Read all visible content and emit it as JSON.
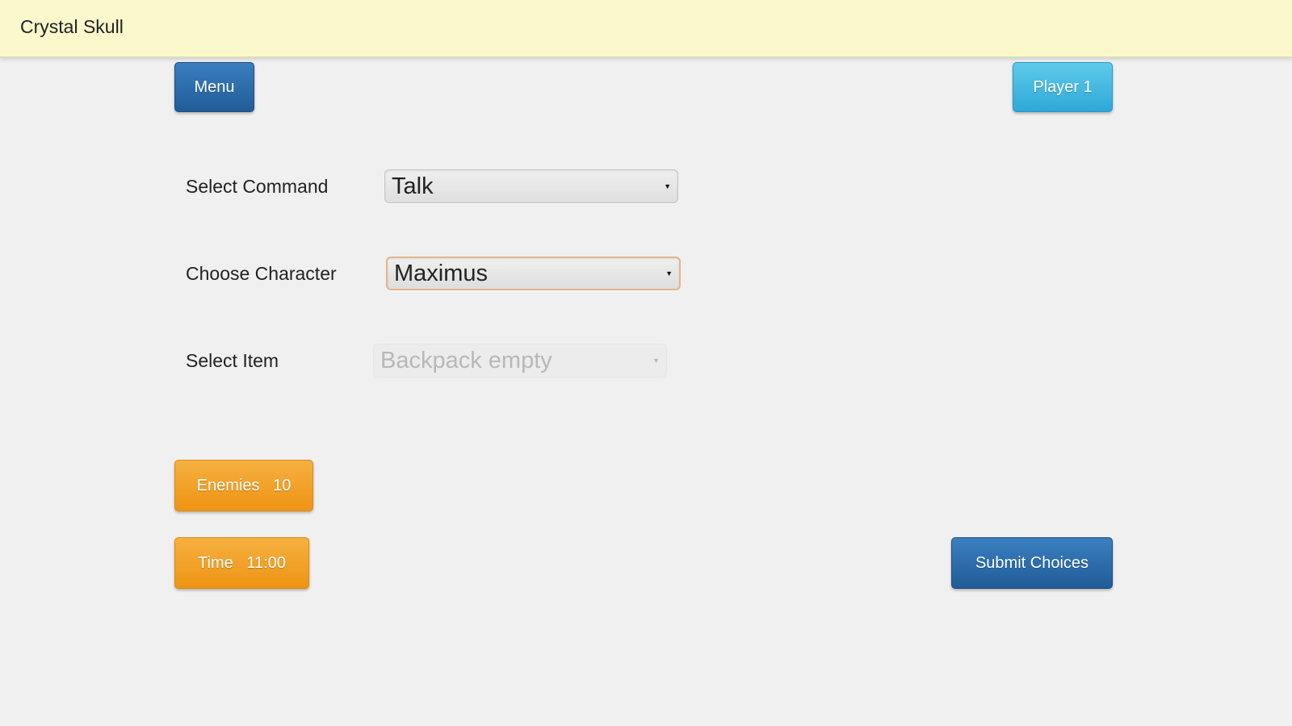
{
  "app": {
    "title": "Crystal Skull"
  },
  "toolbar": {
    "menu_label": "Menu",
    "player_label": "Player 1"
  },
  "form": {
    "command": {
      "label": "Select Command",
      "value": "Talk"
    },
    "character": {
      "label": "Choose Character",
      "value": "Maximus"
    },
    "item": {
      "label": "Select Item",
      "value": "Backpack empty",
      "disabled": true
    }
  },
  "status": {
    "enemies_label": "Enemies   10",
    "time_label": "Time   11:00"
  },
  "actions": {
    "submit_label": "Submit Choices"
  },
  "icons": {
    "dropdown": "caret-down-icon"
  },
  "colors": {
    "title_bar": "#fbf9cc",
    "primary_blue": "#215c97",
    "player_cyan": "#2ea8d8",
    "status_orange": "#ee9414",
    "focus_border": "#e6b48a"
  }
}
